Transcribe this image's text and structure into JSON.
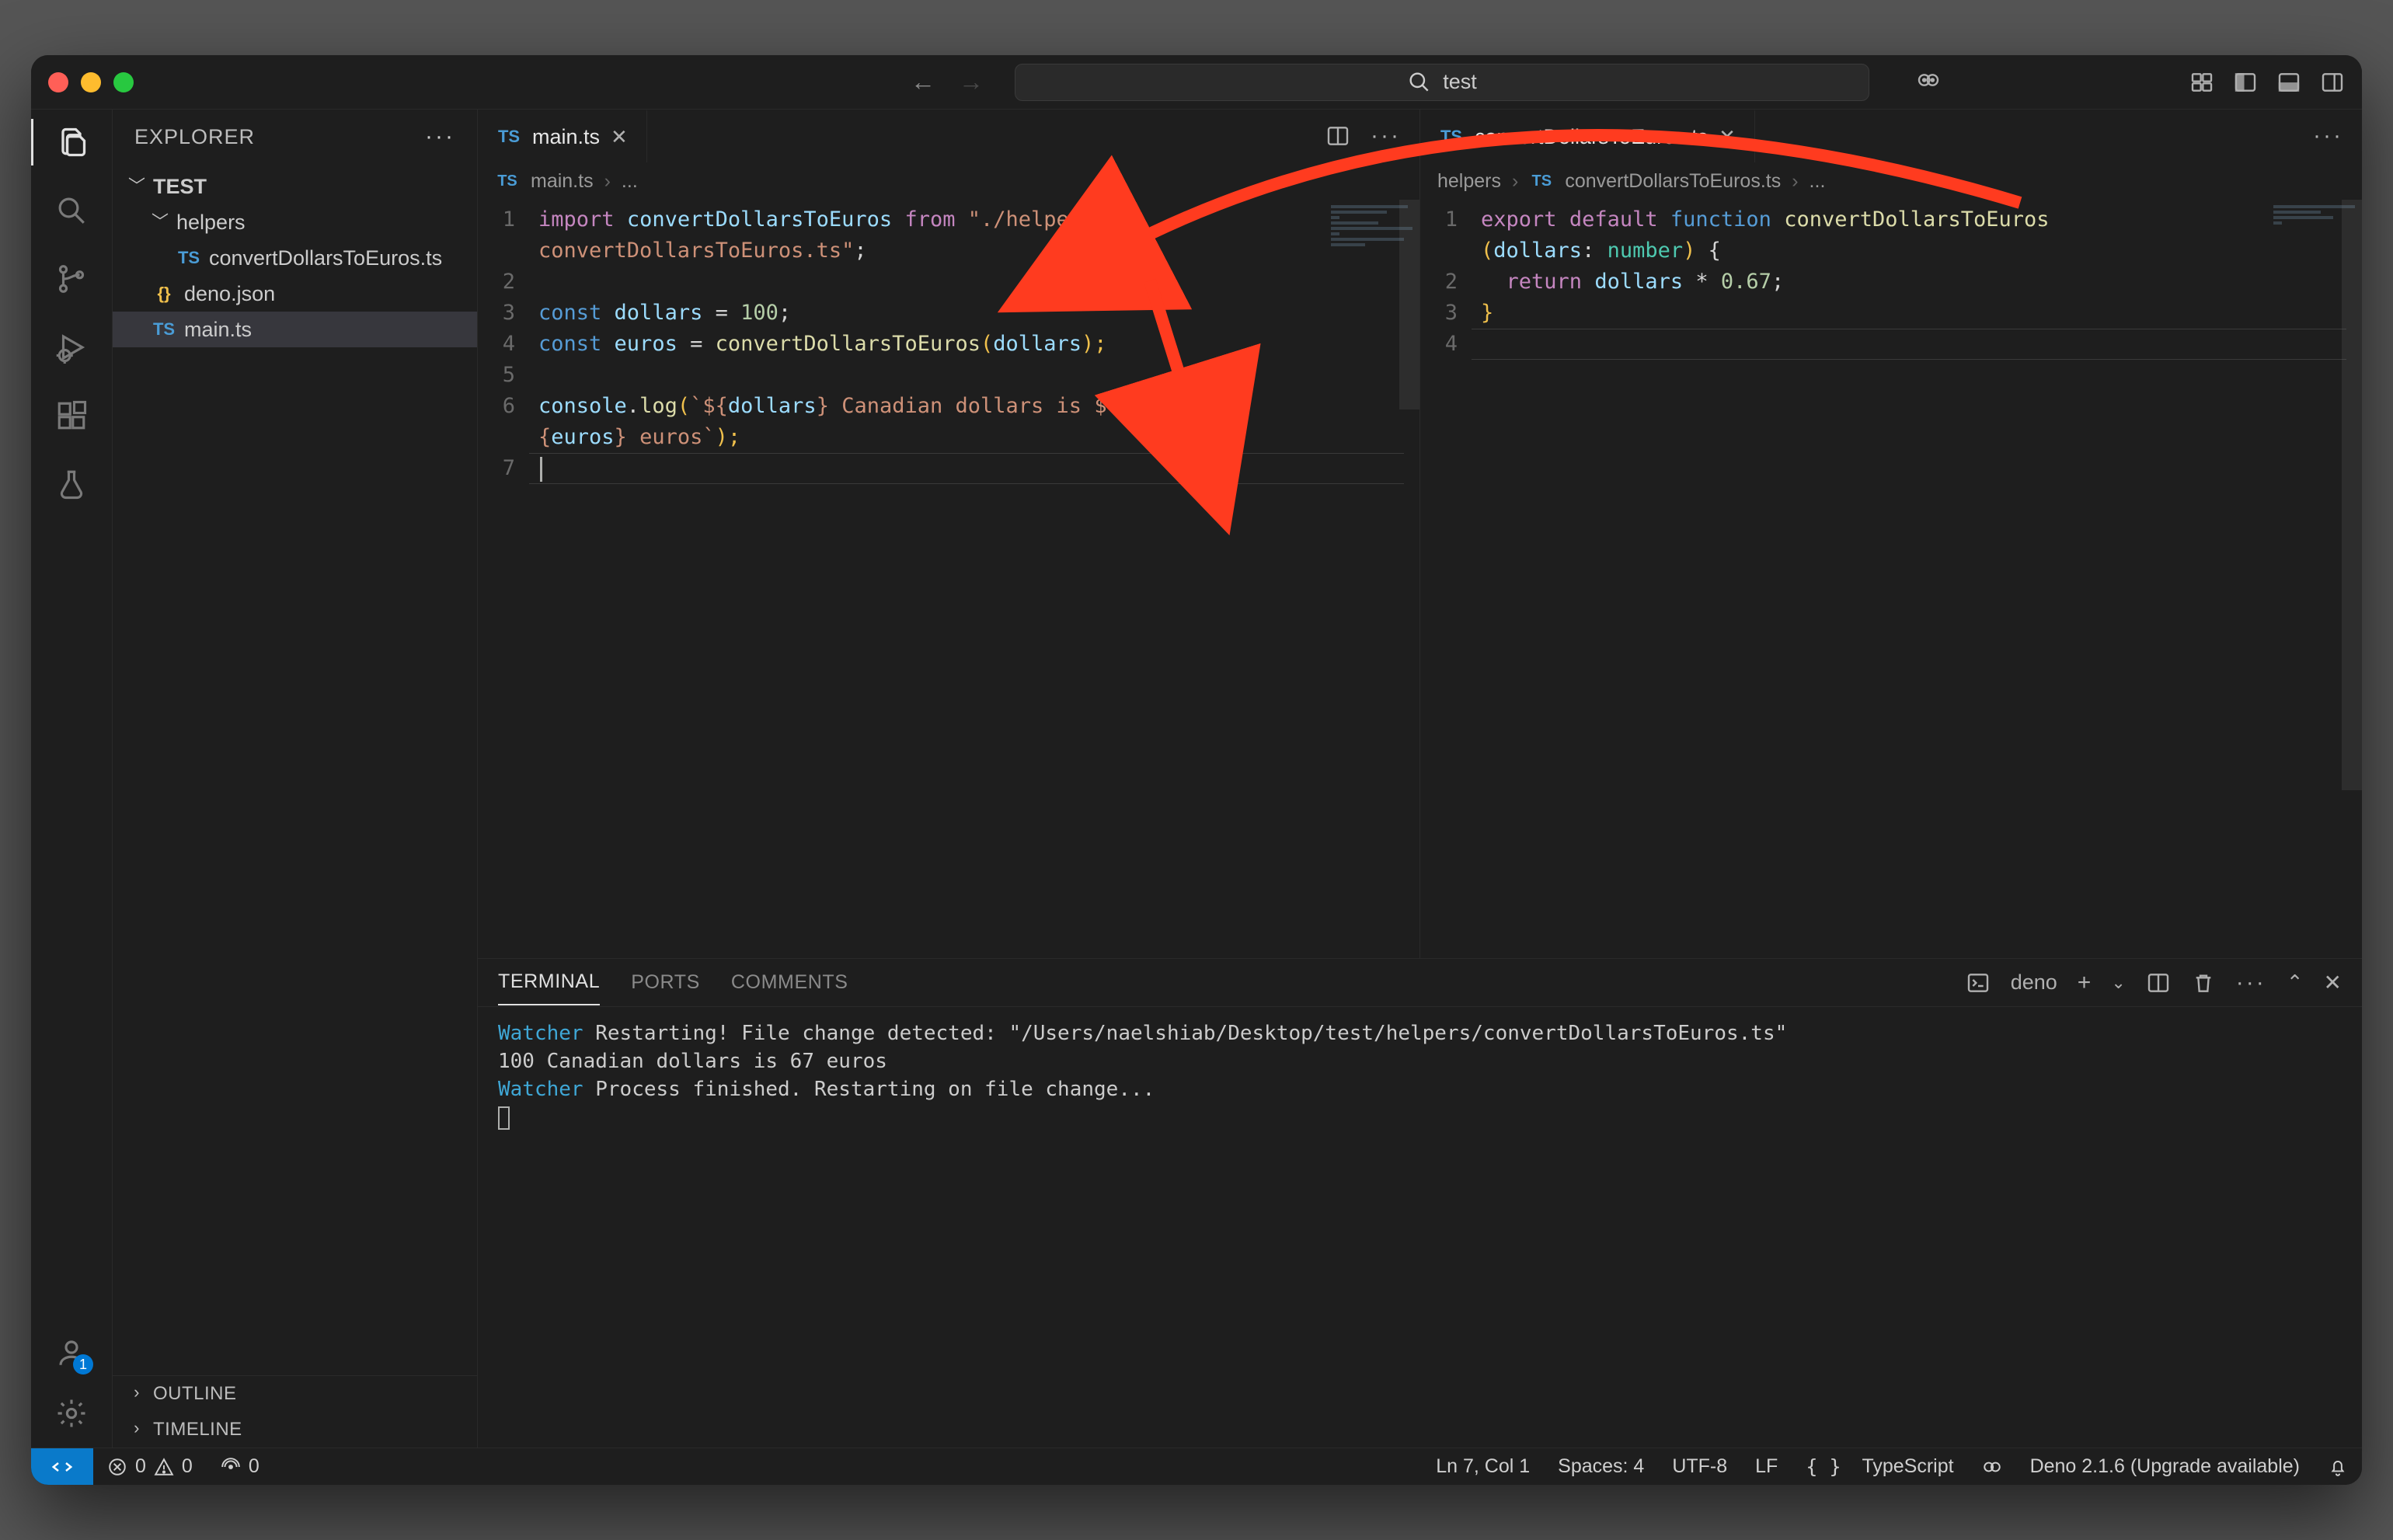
{
  "titlebar": {
    "search_text": "test"
  },
  "sidebar": {
    "title": "EXPLORER",
    "root": "TEST",
    "folder1": "helpers",
    "file1": "convertDollarsToEuros.ts",
    "file2": "deno.json",
    "file3": "main.ts",
    "outline": "OUTLINE",
    "timeline": "TIMELINE",
    "account_badge": "1"
  },
  "editor_left": {
    "tab": "main.ts",
    "crumb1": "main.ts",
    "crumb2": "...",
    "lines": [
      "1",
      "2",
      "3",
      "4",
      "5",
      "6",
      "",
      "7"
    ],
    "c1a": "import",
    "c1b": "convertDollarsToEuros",
    "c1c": "from",
    "c1d": "\"./helpers/",
    "c1e": "convertDollarsToEuros.ts\"",
    "c1f": ";",
    "c3a": "const",
    "c3b": "dollars",
    "c3c": " = ",
    "c3d": "100",
    "c3e": ";",
    "c4a": "const",
    "c4b": "euros",
    "c4c": " = ",
    "c4d": "convertDollarsToEuros",
    "c4e": "(",
    "c4f": "dollars",
    "c4g": ");",
    "c6a": "console",
    "c6b": ".",
    "c6c": "log",
    "c6d": "(",
    "c6e": "`${",
    "c6f": "dollars",
    "c6g": "}",
    "c6h": " Canadian dollars is $",
    "c6i": "{",
    "c6j": "euros",
    "c6k": "}",
    "c6l": " euros`",
    "c6m": ");"
  },
  "editor_right": {
    "tab": "convertDollarsToEuros.ts",
    "crumb0": "helpers",
    "crumb1": "convertDollarsToEuros.ts",
    "crumb2": "...",
    "lines": [
      "1",
      "",
      "2",
      "3",
      "4"
    ],
    "r1a": "export",
    "r1b": "default",
    "r1c": "function",
    "r1d": "convertDollarsToEuros",
    "r1e": "(",
    "r1f": "dollars",
    "r1g": ": ",
    "r1h": "number",
    "r1i": ")",
    "r1j": " {",
    "r2a": "return",
    "r2b": "dollars",
    "r2c": " * ",
    "r2d": "0.67",
    "r2e": ";",
    "r3a": "}"
  },
  "panel": {
    "t1": "TERMINAL",
    "t2": "PORTS",
    "t3": "COMMENTS",
    "shell": "deno",
    "w1": "Watcher",
    "w1b": " Restarting! File change detected: \"/Users/naelshiab/Desktop/test/helpers/convertDollarsToEuros.ts\"",
    "l2": "100 Canadian dollars is 67 euros",
    "w2": "Watcher",
    "w2b": " Process finished. Restarting on file change..."
  },
  "status": {
    "err": "0",
    "warn": "0",
    "ports": "0",
    "pos": "Ln 7, Col 1",
    "spaces": "Spaces: 4",
    "enc": "UTF-8",
    "eol": "LF",
    "lang": "TypeScript",
    "deno": "Deno 2.1.6 (Upgrade available)"
  }
}
